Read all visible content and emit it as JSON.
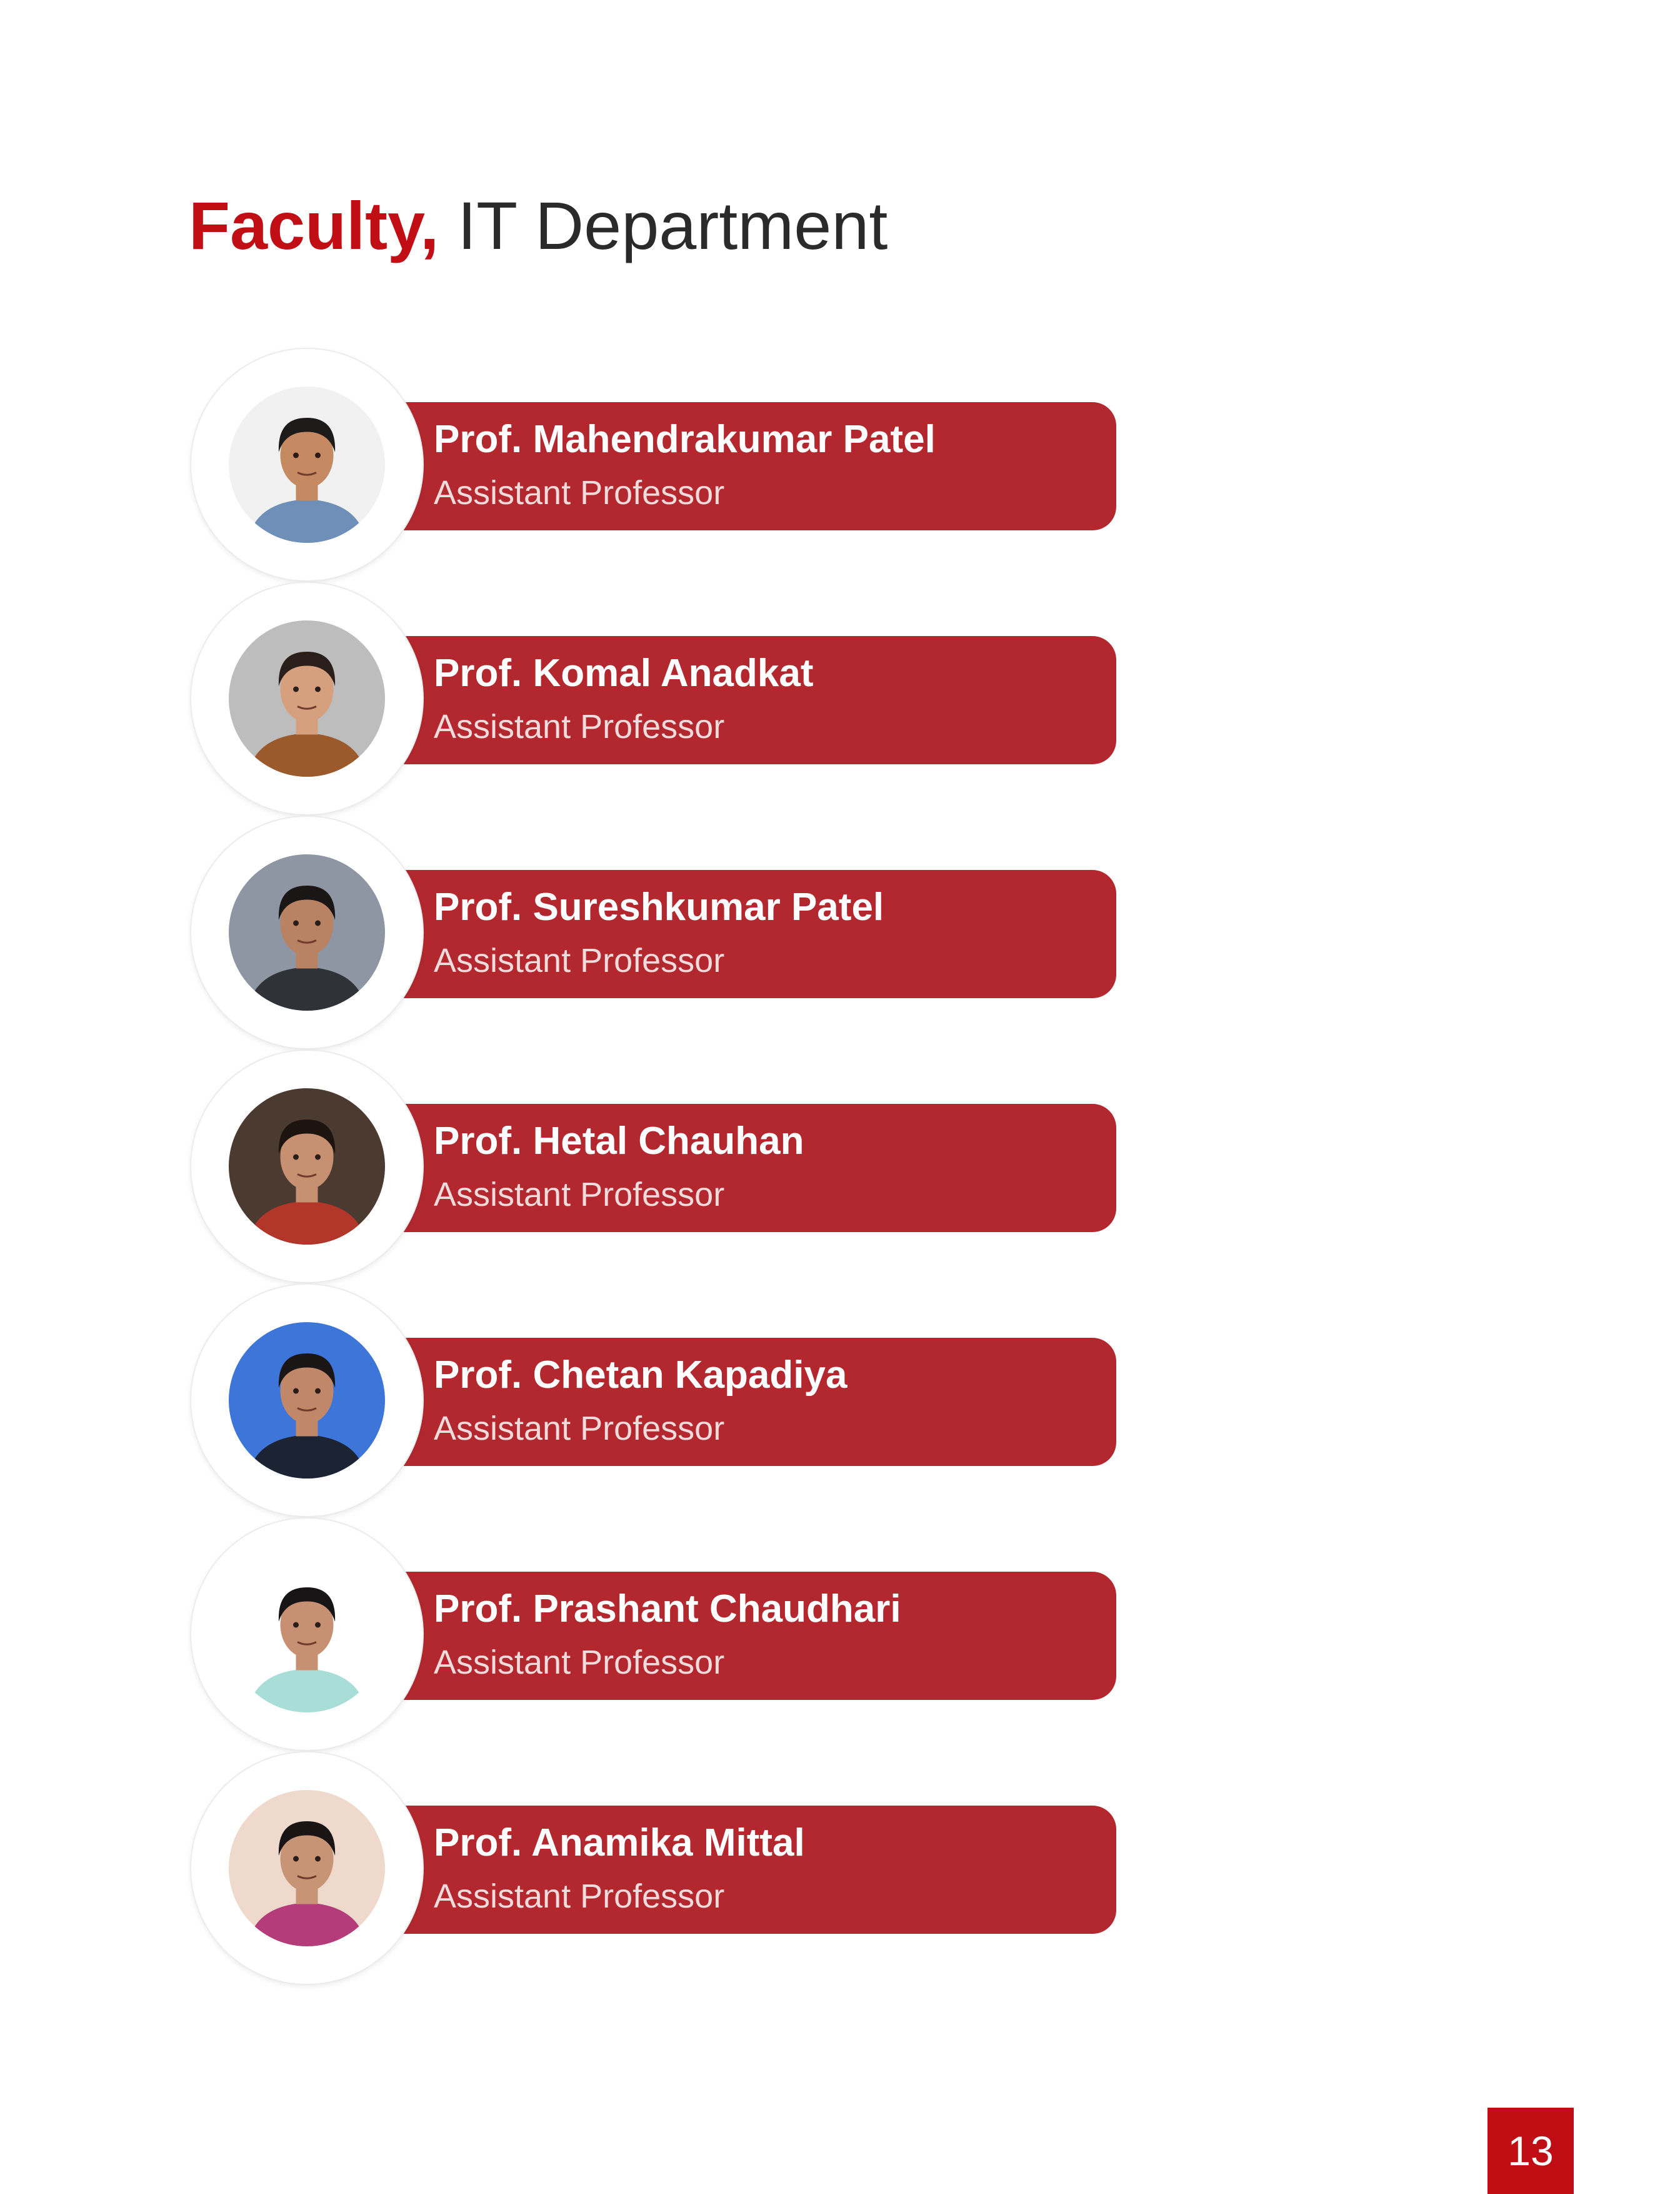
{
  "page": {
    "title_strong": "Faculty,",
    "title_rest": " IT Department",
    "page_number": "13"
  },
  "colors": {
    "accent_red": "#c00e14",
    "card_red": "#b3282f"
  },
  "faculty": [
    {
      "name": "Prof. Mahendrakumar Patel",
      "role": "Assistant Professor",
      "bg": "#f1f1f1",
      "skin": "#c58a62",
      "hair": "#1d1a1a",
      "shirt": "#6d8fb8"
    },
    {
      "name": "Prof. Komal Anadkat",
      "role": "Assistant Professor",
      "bg": "#bdbdbd",
      "skin": "#d6a07e",
      "hair": "#2a1e1a",
      "shirt": "#9a5a2c"
    },
    {
      "name": "Prof. Sureshkumar Patel",
      "role": "Assistant Professor",
      "bg": "#8e96a4",
      "skin": "#b98262",
      "hair": "#1a1616",
      "shirt": "#2f3338"
    },
    {
      "name": "Prof. Hetal Chauhan",
      "role": "Assistant Professor",
      "bg": "#4a3a30",
      "skin": "#c79070",
      "hair": "#1d1410",
      "shirt": "#b3362a"
    },
    {
      "name": "Prof. Chetan Kapadiya",
      "role": "Assistant Professor",
      "bg": "#3d76d8",
      "skin": "#c08868",
      "hair": "#1a1616",
      "shirt": "#1c2333"
    },
    {
      "name": "Prof. Prashant Chaudhari",
      "role": "Assistant Professor",
      "bg": "#ffffff",
      "skin": "#c89072",
      "hair": "#161414",
      "shirt": "#a9ded8"
    },
    {
      "name": "Prof. Anamika Mittal",
      "role": "Assistant Professor",
      "bg": "#efd9cc",
      "skin": "#c89476",
      "hair": "#1a1414",
      "shirt": "#b43c7a"
    }
  ]
}
